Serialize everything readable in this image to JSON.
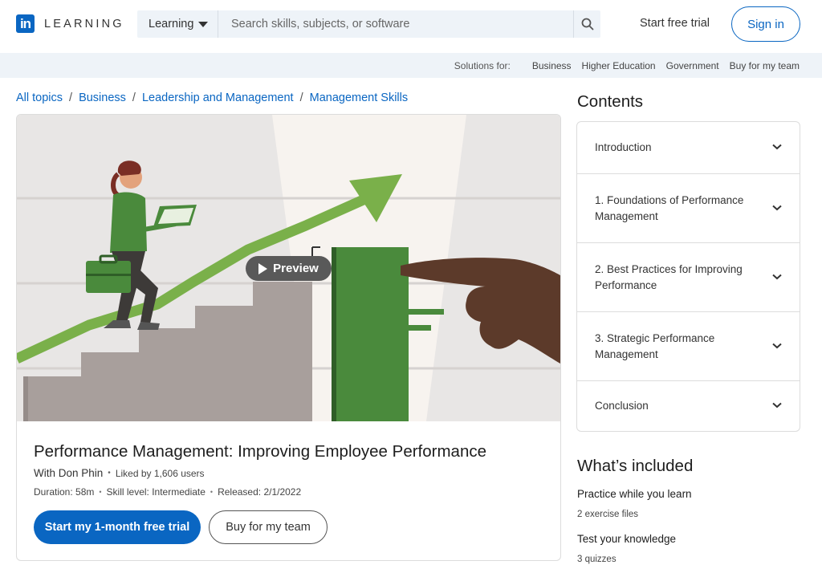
{
  "header": {
    "brand": "LEARNING",
    "logo_text": "in",
    "search_select": "Learning",
    "search_placeholder": "Search skills, subjects, or software",
    "start_trial": "Start free trial",
    "sign_in": "Sign in"
  },
  "solutions": {
    "label": "Solutions for:",
    "items": [
      "Business",
      "Higher Education",
      "Government",
      "Buy for my team"
    ]
  },
  "breadcrumb": [
    "All topics",
    "Business",
    "Leadership and Management",
    "Management Skills"
  ],
  "course": {
    "preview_label": "Preview",
    "title": "Performance Management: Improving Employee Performance",
    "author": "With Don Phin",
    "likes": "Liked by 1,606 users",
    "duration": "Duration: 58m",
    "skill_level": "Skill level: Intermediate",
    "released": "Released: 2/1/2022",
    "primary_cta": "Start my 1-month free trial",
    "secondary_cta": "Buy for my team"
  },
  "contents": {
    "title": "Contents",
    "items": [
      "Introduction",
      "1. Foundations of Performance Management",
      "2. Best Practices for Improving Performance",
      "3. Strategic Performance Management",
      "Conclusion"
    ]
  },
  "included": {
    "title": "What’s included",
    "items": [
      {
        "heading": "Practice while you learn",
        "detail": "2 exercise files"
      },
      {
        "heading": "Test your knowledge",
        "detail": "3 quizzes"
      }
    ]
  },
  "colors": {
    "accent": "#0a66c2",
    "hero_green": "#4a8a3c",
    "hero_green_light": "#7ab04a",
    "stair_gray": "#a89f9c"
  }
}
